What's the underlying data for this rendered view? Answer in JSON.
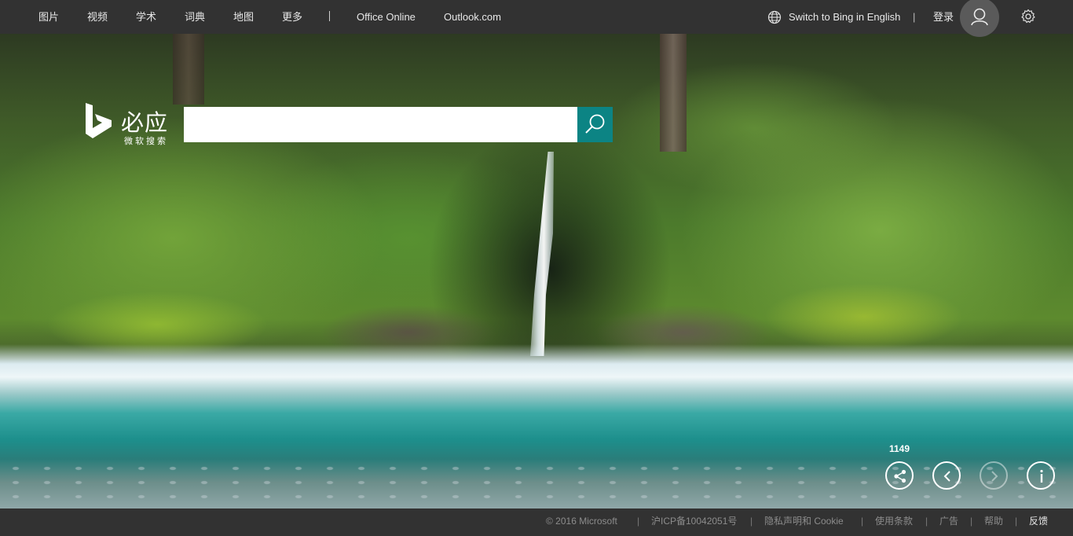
{
  "nav": {
    "items": [
      "图片",
      "视频",
      "学术",
      "词典",
      "地图",
      "更多"
    ],
    "office": "Office Online",
    "outlook": "Outlook.com"
  },
  "account": {
    "switch_label": "Switch to Bing in English",
    "login_label": "登录"
  },
  "logo": {
    "title": "必应",
    "subtitle": "微软搜索"
  },
  "search": {
    "value": ""
  },
  "image_controls": {
    "share_count": "1149"
  },
  "footer": {
    "copyright": "© 2016 Microsoft",
    "icp": "沪ICP备10042051号",
    "privacy": "隐私声明和 Cookie",
    "terms": "使用条款",
    "ads": "广告",
    "help": "帮助",
    "feedback": "反馈"
  },
  "colors": {
    "bar_bg": "#323232",
    "search_button": "#0c8484"
  }
}
